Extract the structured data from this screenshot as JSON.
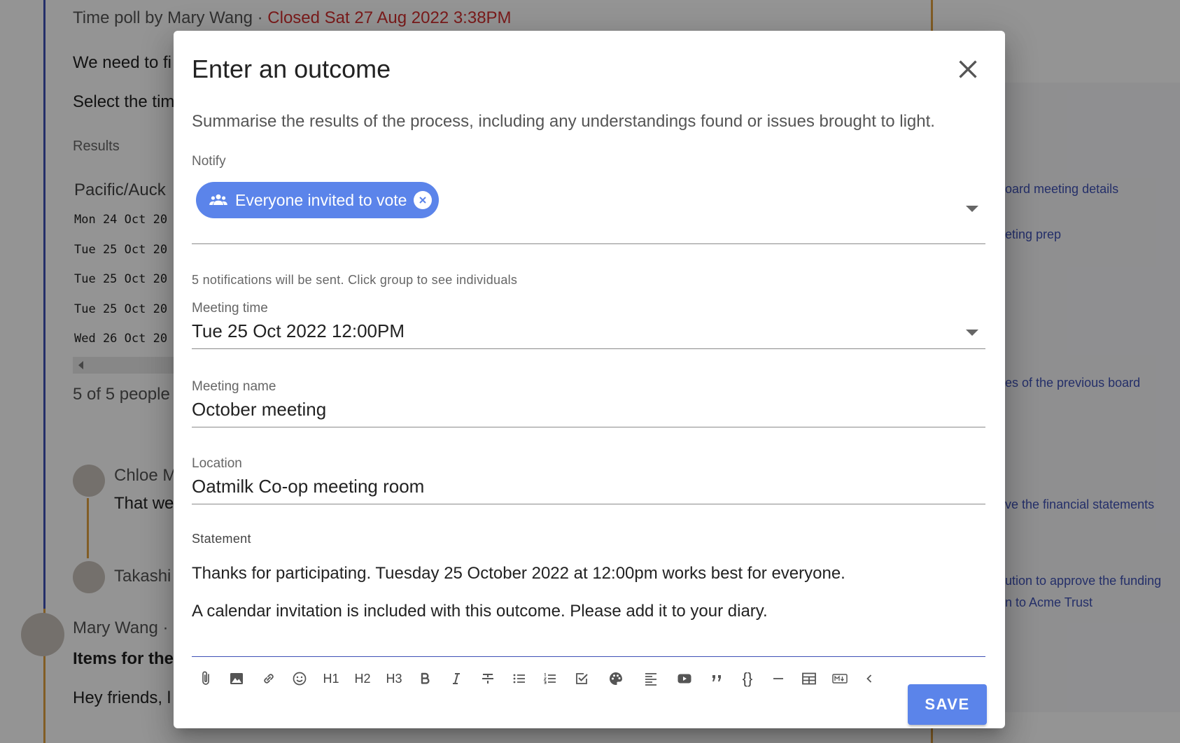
{
  "background": {
    "poll_header_prefix": "Time poll by Mary Wang · ",
    "poll_header_closed": "Closed Sat 27 Aug 2022 3:38PM",
    "body_line1": "We need to fi",
    "body_line2": "Select the tim",
    "results_label": "Results",
    "timezone": "Pacific/Auck",
    "dates": [
      "Mon 24 Oct 20",
      "Tue 25 Oct 20",
      "Tue 25 Oct 20",
      "Tue 25 Oct 20",
      "Wed 26 Oct 20"
    ],
    "voted_count": "5 of 5 people",
    "comment1_author": "Chloe M",
    "comment1_text": "That we",
    "comment2_author": "Takashi",
    "comment3_author": "Mary Wang ·",
    "comment3_title": "Items for the",
    "comment3_text": "Hey friends, l",
    "side_links": [
      "oard meeting details",
      "eting prep",
      "es of the previous board",
      "ve the financial statements",
      "ution to approve the funding",
      "n to Acme Trust"
    ]
  },
  "dialog": {
    "title": "Enter an outcome",
    "intro": "Summarise the results of the process, including any understandings found or issues brought to light.",
    "notify": {
      "label": "Notify",
      "chip_label": "Everyone invited to vote",
      "helper": "5 notifications will be sent. Click group to see individuals"
    },
    "meeting_time": {
      "label": "Meeting time",
      "value": "Tue 25 Oct 2022 12:00PM"
    },
    "meeting_name": {
      "label": "Meeting name",
      "value": "October meeting"
    },
    "location": {
      "label": "Location",
      "value": "Oatmilk Co-op meeting room"
    },
    "statement": {
      "label": "Statement",
      "line1": "Thanks for participating.  Tuesday 25 October 2022 at 12:00pm works best for everyone.",
      "line2": "A calendar invitation is included with this outcome. Please add it to your diary."
    },
    "toolbar": {
      "h1": "H1",
      "h2": "H2",
      "h3": "H3",
      "code": "{}"
    },
    "save_label": "SAVE"
  },
  "colors": {
    "accent": "#5b84ea",
    "primary": "#3f51b5",
    "closed_red": "#d32f2f"
  }
}
